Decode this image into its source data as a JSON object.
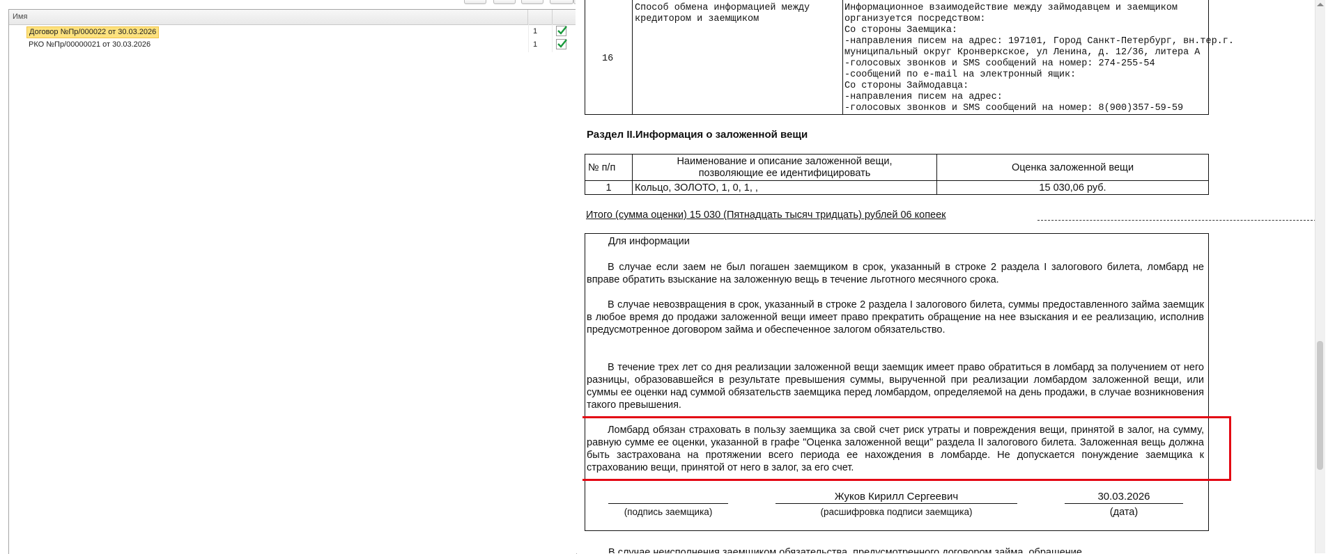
{
  "list": {
    "column_name": "Имя",
    "rows": [
      {
        "name": "Договор №Пр/000022 от 30.03.2026",
        "count": "1",
        "checked": true
      },
      {
        "name": "РКО №Пр/00000021 от 30.03.2026",
        "count": "1",
        "checked": true
      }
    ]
  },
  "document": {
    "row16": {
      "number": "16",
      "label_lines": [
        "Способ обмена информацией между",
        "кредитором и заемщиком"
      ],
      "value_lines": [
        "Информационное взаимодействие между займодавцем и заемщиком",
        "организуется посредством:",
        "Со стороны Заемщика:",
        "-направления писем на адрес: 197101, Город Санкт-Петербург, вн.тер.г.",
        "муниципальный округ Кронверкское, ул Ленина, д. 12/36, литера А",
        "-голосовых звонков и SMS сообщений на номер: 274-255-54",
        "-сообщений по e-mail на электронный ящик:",
        "Со стороны Займодавца:",
        "-направления писем на адрес:",
        "-голосовых звонков и SMS сообщений на номер: 8(900)357-59-59"
      ]
    },
    "section2_title": "Раздел II.Информация о заложенной вещи",
    "pledge_table": {
      "header_num": "№ п/п",
      "header_desc_lines": [
        "Наименование и описание заложенной вещи,",
        "позволяющие ее идентифицировать"
      ],
      "header_value": "Оценка заложенной вещи",
      "row": {
        "num": "1",
        "desc": "Кольцо, ЗОЛОТО,  1, 0, 1, ,",
        "value": "15 030,06 руб."
      }
    },
    "total_line": "Итого (сумма оценки)     15 030 (Пятнадцать тысяч тридцать) рублей 06 копеек",
    "info": {
      "title": "Для информации",
      "p1": "В случае если заем не был погашен заемщиком в срок, указанный в строке 2 раздела I залогового билета, ломбард не вправе обратить взыскание на заложенную вещь в течение льготного месячного срока.",
      "p2": "В случае  невозвращения  в  срок,  указанный  в строке 2  раздела I залогового билета, суммы предоставленного займа заемщик в любое время до продажи  заложенной  вещи  имеет  право  прекратить обращение  на  нее взыскания и ее реализацию, исполнив предусмотренное договором займа и обеспеченное залогом обязательство.",
      "p3": "В течение трех лет со дня реализации заложенной вещи заемщик имеет право обратиться в ломбард за получением от него разницы, образовавшейся в результате  превышения  суммы,  вырученной  при реализации ломбардом заложенной вещи, или суммы ее оценки над суммой обязательств заемщика перед ломбардом, определяемой на день продажи, в случае возникновения такого превышения.",
      "p4": "Ломбард обязан страховать в пользу заемщика за свой счет риск утраты и повреждения вещи, принятой в залог, на сумму, равную сумме ее оценки, указанной в графе \"Оценка заложенной вещи\" раздела II залогового билета. Заложенная вещь должна быть застрахована на протяжении всего периода ее нахождения в ломбарде. Не допускается понуждение заемщика к страхованию вещи, принятой от него в залог, за его счет."
    },
    "signature": {
      "name": "Жуков Кирилл Сергеевич",
      "date": "30.03.2026",
      "label_signature": "(подпись заемщика)",
      "label_decode": "(расшифровка подписи заемщика)",
      "label_date": "(дата)"
    },
    "footer_text": "В случае неисполнения заемщиком обязательства, предусмотренного договором займа, обращение"
  },
  "colors": {
    "highlight": "#fde27e",
    "check": "#1a9a3c",
    "annotation": "#e30613"
  }
}
